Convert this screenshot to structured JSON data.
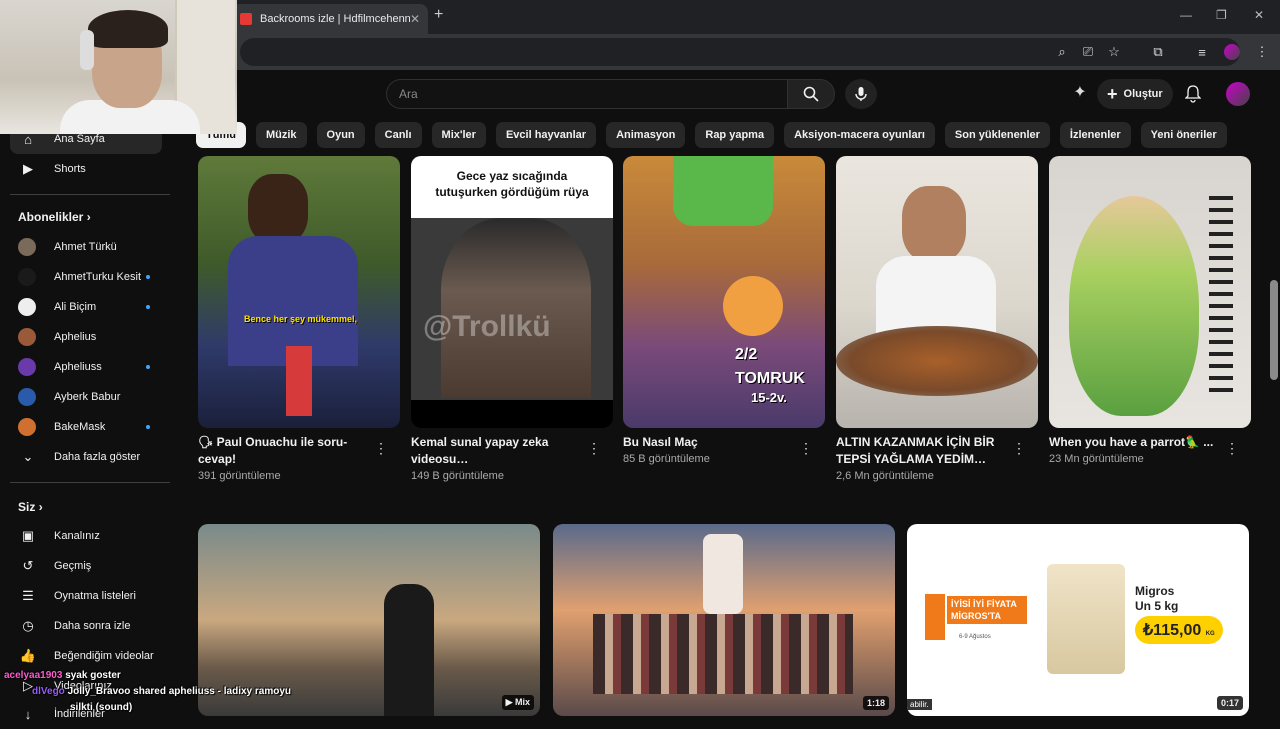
{
  "browser": {
    "tab_title": "Backrooms izle | Hdfilmcehennemi",
    "tab_close": "✕",
    "new_tab": "+",
    "win_min": "—",
    "win_max": "❐",
    "win_close": "✕"
  },
  "header": {
    "search_placeholder": "Ara",
    "create_label": "Oluştur"
  },
  "sidebar": {
    "home": "Ana Sayfa",
    "shorts": "Shorts",
    "subs_heading": "Abonelikler",
    "subs": [
      {
        "name": "Ahmet Türkü",
        "dot": false,
        "color": "#7a6a5a"
      },
      {
        "name": "AhmetTurku Kesit",
        "dot": true,
        "color": "#1a1a1a"
      },
      {
        "name": "Ali Biçim",
        "dot": true,
        "color": "#eeeeee"
      },
      {
        "name": "Aphelius",
        "dot": false,
        "color": "#9a5a3a"
      },
      {
        "name": "Apheliuss",
        "dot": true,
        "color": "#6a3aaa"
      },
      {
        "name": "Ayberk Babur",
        "dot": false,
        "color": "#2a5aaa"
      },
      {
        "name": "BakeMask",
        "dot": true,
        "color": "#d07030"
      }
    ],
    "show_more": "Daha fazla göster",
    "you_heading": "Siz",
    "you_items": [
      "Kanalınız",
      "Geçmiş",
      "Oynatma listeleri",
      "Daha sonra izle",
      "Beğendiğim videolar",
      "Videolarınız",
      "İndirilenler"
    ]
  },
  "chips": [
    "Tümü",
    "Müzik",
    "Oyun",
    "Canlı",
    "Mix'ler",
    "Evcil hayvanlar",
    "Animasyon",
    "Rap yapma",
    "Aksiyon-macera oyunları",
    "Son yüklenenler",
    "İzlenenler",
    "Yeni öneriler"
  ],
  "shorts": [
    {
      "title": "🗣 Paul Onuachu ile soru-cevap!",
      "views": "391 görüntüleme",
      "overlay": "Bence her şey mükemmel,"
    },
    {
      "title": "Kemal sunal yapay zeka videosu…",
      "views": "149 B görüntüleme",
      "overlay": "Gece yaz sıcağında tutuşurken gördüğüm rüya",
      "watermark": "@Trollkü"
    },
    {
      "title": "Bu Nasıl Maç",
      "views": "85 B görüntüleme",
      "overlay": "2/2",
      "overlay2": "TOMRUK",
      "overlay3": "15-2v."
    },
    {
      "title": "ALTIN KAZANMAK İÇİN BİR TEPSİ YAĞLAMA YEDİM…",
      "views": "2,6 Mn görüntüleme"
    },
    {
      "title": "When you have a parrot🦜 ...",
      "views": "23 Mn görüntüleme"
    }
  ],
  "videos": [
    {
      "badge": "Mix"
    },
    {
      "badge": "1:18"
    },
    {
      "badge": "0:17",
      "brand": "Migros",
      "product": "Un 5 kg",
      "price": "₺115,00",
      "unit": "KG",
      "slogan": "İYİSİ İYİ FİYATA MİGROS'TA",
      "dates": "6-9 Ağustos",
      "caption": "abilir."
    }
  ],
  "chat": [
    {
      "user": "acelyaa1903",
      "msg": "syak goster"
    },
    {
      "user": "dlVego",
      "msg": "Jolly_Bravoo shared apheliuss - ladixy ramoyu"
    },
    {
      "user": "",
      "msg": "silkti (sound)"
    }
  ],
  "colors": {
    "bg": "#0f0f0f",
    "chip": "#272727",
    "accent": "#3ea6ff"
  }
}
